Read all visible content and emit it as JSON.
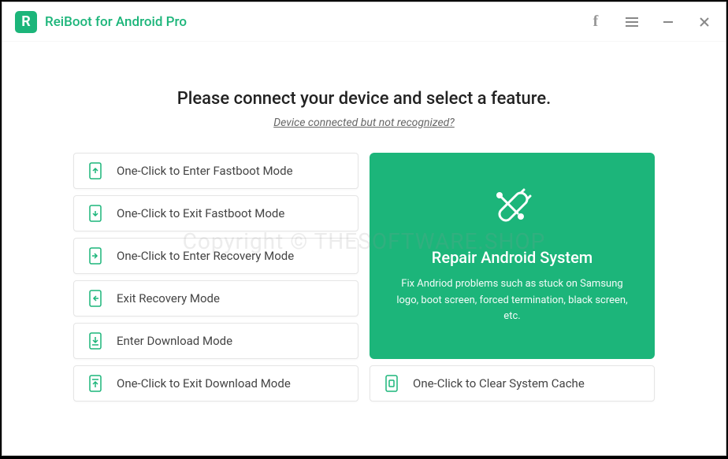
{
  "app": {
    "title": "ReiBoot for Android Pro",
    "logo_letter": "R"
  },
  "heading": "Please connect your device and select a feature.",
  "subtext": "Device connected but not recognized?",
  "options": {
    "enter_fastboot": "One-Click to Enter Fastboot Mode",
    "exit_fastboot": "One-Click to Exit Fastboot Mode",
    "enter_recovery": "One-Click to Enter Recovery Mode",
    "exit_recovery": "Exit Recovery Mode",
    "enter_download": "Enter Download Mode",
    "exit_download": "One-Click to Exit Download Mode",
    "clear_cache": "One-Click to Clear System Cache"
  },
  "repair_card": {
    "title": "Repair Android System",
    "description": "Fix Andriod problems such as stuck on Samsung logo, boot screen, forced termination, black screen, etc."
  },
  "watermark": "Copyright © THESOFTWARE.SHOP"
}
